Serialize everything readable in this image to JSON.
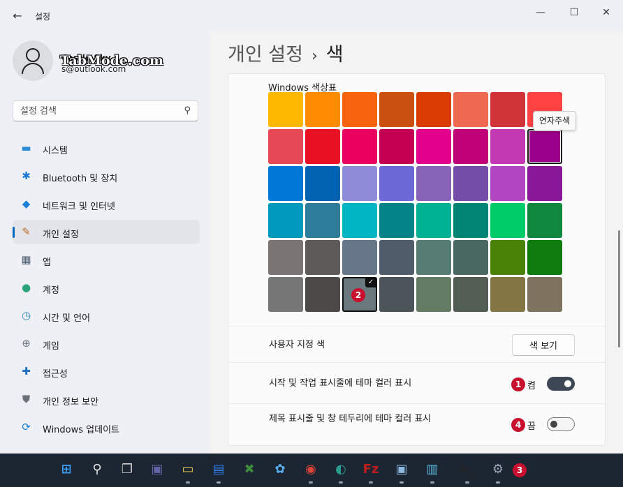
{
  "window": {
    "app_title": "설정",
    "back_icon": "arrow-left-icon",
    "controls": [
      "minimize-icon",
      "maximize-icon",
      "close-icon"
    ]
  },
  "profile": {
    "name": "Castle Sky",
    "email": "s@outlook.com",
    "watermark": "TabMode.com"
  },
  "search": {
    "placeholder": "설정 검색",
    "icon": "search-icon"
  },
  "nav": [
    {
      "label": "시스템",
      "icon": "monitor-icon"
    },
    {
      "label": "Bluetooth 및 장치",
      "icon": "bluetooth-icon"
    },
    {
      "label": "네트워크 및 인터넷",
      "icon": "wifi-icon"
    },
    {
      "label": "개인 설정",
      "icon": "brush-icon",
      "active": true
    },
    {
      "label": "앱",
      "icon": "apps-icon"
    },
    {
      "label": "계정",
      "icon": "person-icon"
    },
    {
      "label": "시간 및 언어",
      "icon": "globe-clock-icon"
    },
    {
      "label": "게임",
      "icon": "gamepad-icon"
    },
    {
      "label": "접근성",
      "icon": "accessibility-icon"
    },
    {
      "label": "개인 정보 보안",
      "icon": "shield-icon"
    },
    {
      "label": "Windows 업데이트",
      "icon": "update-icon"
    }
  ],
  "page": {
    "crumb": "개인 설정",
    "separator": "›",
    "title": "색"
  },
  "palette": {
    "label": "Windows 색상표",
    "tooltip": "연자주색",
    "rows": [
      [
        "#ffb900",
        "#ff8c00",
        "#f7630c",
        "#ca5010",
        "#da3b01",
        "#ef6950",
        "#d13438",
        "#ff4343"
      ],
      [
        "#e74856",
        "#e81123",
        "#ea005e",
        "#c30052",
        "#e3008c",
        "#bf0077",
        "#c239b3",
        "#9a0089"
      ],
      [
        "#0078d7",
        "#0063b1",
        "#8e8cd8",
        "#6b69d6",
        "#8764b8",
        "#744da9",
        "#b146c2",
        "#881798"
      ],
      [
        "#0099bc",
        "#2d7d9a",
        "#00b7c3",
        "#038387",
        "#00b294",
        "#018574",
        "#00cc6a",
        "#10893e"
      ],
      [
        "#7a7574",
        "#5d5a58",
        "#68768a",
        "#515c6b",
        "#567c73",
        "#486860",
        "#498205",
        "#107c10"
      ],
      [
        "#767676",
        "#4c4a48",
        "#69797e",
        "#4a5459",
        "#647c64",
        "#525e54",
        "#847545",
        "#7e735f"
      ]
    ],
    "selected": [
      5,
      2
    ],
    "current": [
      1,
      7
    ]
  },
  "custom_color": {
    "label": "사용자 지정 색",
    "button": "색 보기"
  },
  "toggles": [
    {
      "label": "시작 및 작업 표시줄에 테마 컬러 표시",
      "state": "켬",
      "on": true
    },
    {
      "label": "제목 표시줄 및 창 테두리에 테마 컬러 표시",
      "state": "끔",
      "on": false
    }
  ],
  "badges": [
    "1",
    "2",
    "3",
    "4"
  ],
  "taskbar": {
    "icons": [
      {
        "name": "start-icon",
        "color": "#3a9bf0"
      },
      {
        "name": "search-icon",
        "color": "#e8e8e8"
      },
      {
        "name": "task-view-icon",
        "color": "#cfcfcf"
      },
      {
        "name": "chat-icon",
        "color": "#6264a7"
      },
      {
        "name": "file-explorer-icon",
        "color": "#f2c94c"
      },
      {
        "name": "store-icon",
        "color": "#2f80ed"
      },
      {
        "name": "xbox-icon",
        "color": "#3d8d3a"
      },
      {
        "name": "paint-icon",
        "color": "#5ab0f0"
      },
      {
        "name": "chrome-icon",
        "color": "#e0453a"
      },
      {
        "name": "edge-icon",
        "color": "#2a9d8f"
      },
      {
        "name": "filezilla-icon",
        "color": "#bf1f1f"
      },
      {
        "name": "remote-desktop-icon",
        "color": "#8fb8de"
      },
      {
        "name": "buildings-icon",
        "color": "#5bb7d9"
      },
      {
        "name": "terminal-icon",
        "color": "#222222"
      },
      {
        "name": "settings-icon",
        "color": "#9aa7b5"
      }
    ]
  }
}
